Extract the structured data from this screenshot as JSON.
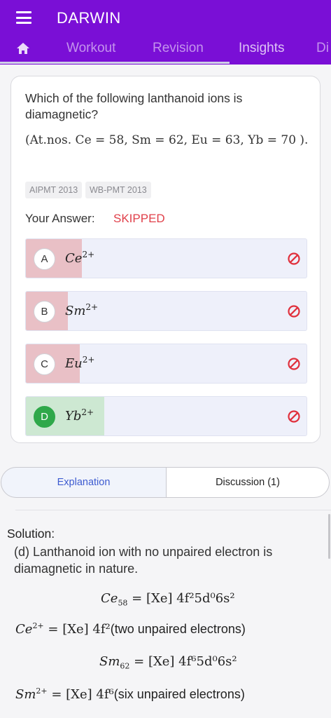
{
  "app": {
    "title": "DARWIN",
    "header_color": "#7a0fd6"
  },
  "tabs": [
    {
      "label": "Workout"
    },
    {
      "label": "Revision"
    },
    {
      "label": "Insights"
    },
    {
      "label": "Di"
    }
  ],
  "question": {
    "text": "Which of the following lanthanoid ions is diamagnetic?",
    "atnos": "(At.nos. Ce = 58,  Sm = 62,  Eu = 63, Yb = 70 ).",
    "tags": [
      "AIPMT 2013",
      "WB-PMT 2013"
    ],
    "answer_label": "Your Answer:",
    "answer_value": "SKIPPED"
  },
  "options": [
    {
      "letter": "A",
      "base": "Ce",
      "charge": "2+",
      "status": "wrong"
    },
    {
      "letter": "B",
      "base": "Sm",
      "charge": "2+",
      "status": "wrong"
    },
    {
      "letter": "C",
      "base": "Eu",
      "charge": "2+",
      "status": "wrong"
    },
    {
      "letter": "D",
      "base": "Yb",
      "charge": "2+",
      "status": "correct"
    }
  ],
  "segments": {
    "explanation": "Explanation",
    "discussion": "Discussion (1)"
  },
  "solution": {
    "title": "Solution:",
    "text": "(d) Lanthanoid ion with no unpaired electron is diamagnetic in nature.",
    "eq1": {
      "lhs": "Ce",
      "sub": "58",
      "rhs": "= [Xe] 4f²5d⁰6s²"
    },
    "eq2": {
      "lhs": "Ce",
      "sup": "2+",
      "rhs": "= [Xe] 4f²",
      "note": "(two unpaired electrons)"
    },
    "eq3": {
      "lhs": "Sm",
      "sub": "62",
      "rhs": "= [Xe] 4f⁶5d⁰6s²"
    },
    "eq4": {
      "lhs": "Sm",
      "sup": "2+",
      "rhs": "= [Xe] 4f⁶",
      "note": "(six unpaired electrons)"
    }
  }
}
